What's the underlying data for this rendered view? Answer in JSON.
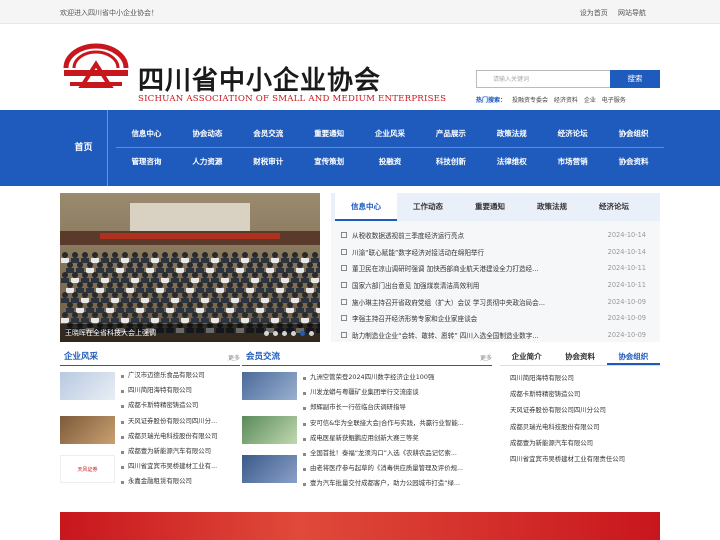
{
  "topbar": {
    "welcome": "欢迎进入四川省中小企业协会！",
    "links": [
      "设为首页",
      "网站导航"
    ]
  },
  "logo": {
    "cn": "四川省中小企业协会",
    "en": "SICHUAN ASSOCIATION OF SMALL AND MEDIUM ENTERPRISES"
  },
  "search": {
    "placeholder": "请输入关键词",
    "button": "搜索",
    "hot_label": "热门搜索：",
    "hot": [
      "投融资专委会",
      "经济资料",
      "企业",
      "电子服务"
    ]
  },
  "nav": {
    "home": "首页",
    "row1": [
      "信息中心",
      "协会动态",
      "会员交流",
      "重要通知",
      "企业风采",
      "产品展示",
      "政策法规",
      "经济论坛",
      "协会组织"
    ],
    "row2": [
      "管理咨询",
      "人力资源",
      "财税审计",
      "宣传策划",
      "投融资",
      "科技创新",
      "法律维权",
      "市场营销",
      "协会资料"
    ]
  },
  "slider": {
    "caption": "王晓晖在全省科技大会上强调",
    "dots": 6
  },
  "news": {
    "tabs": [
      "信息中心",
      "工作动态",
      "重要通知",
      "政策法规",
      "经济论坛"
    ],
    "items": [
      {
        "title": "从税收数据透视前三季度经济运行亮点",
        "date": "2024-10-14"
      },
      {
        "title": "川渝“联心赋能”数字经济对接活动在绵阳举行",
        "date": "2024-10-14"
      },
      {
        "title": "董卫民在凉山调研时强调 加快西部商业航天港建设全力打造经...",
        "date": "2024-10-11"
      },
      {
        "title": "国家六部门出台意见 加强煤炭清洁高效利用",
        "date": "2024-10-11"
      },
      {
        "title": "施小琳主持召开省政府党组（扩大）会议 学习贯彻中央政治局会...",
        "date": "2024-10-09"
      },
      {
        "title": "李强主持召开经济形势专家和企业家座谈会",
        "date": "2024-10-09"
      },
      {
        "title": "助力制造业企业“会转、敢转、愿转” 四川入选全国制造业数字...",
        "date": "2024-10-09"
      }
    ]
  },
  "fengcai": {
    "title": "企业风采",
    "more": "更多",
    "items": [
      "广汉市迈德乐食品有限公司",
      "四川简阳海特有限公司",
      "成都卡斯特精密铸造公司",
      "天风证券股份有限公司四川分...",
      "成都贝瑞光电科技股份有限公司",
      "成都壹为新能源汽车有限公司",
      "四川省宜宾市吴桥建材工业有...",
      "永嘉金融租赁有限公司"
    ],
    "badge": "天风证券"
  },
  "jiaoliu": {
    "title": "会员交流",
    "more": "更多",
    "items": [
      "九洲空管荣登2024四川数字经济企业100强",
      "川发龙蟒与粤疆矿业集团举行交流座谈",
      "郑辉副市长一行莅临台庆调研指导",
      "安可信&华为全联接大会|合作与实践，共赢行业智能...",
      "成电医星新获鲲鹏应用创新大赛三等奖",
      "全国首批！泰福“龙须沟口”入选《农耕农品记忆索...",
      "由老将医疗参与起草的《消毒供应质量管理及评价规...",
      "壹为汽车批量交付成都客户，助力公园城市打造“绿..."
    ]
  },
  "org": {
    "tabs": [
      "企业简介",
      "协会资料",
      "协会组织"
    ],
    "items": [
      "四川简阳海特有限公司",
      "成都卡斯特精密铸造公司",
      "天风证券股份有限公司四川分公司",
      "成都贝瑞光电科技股份有限公司",
      "成都壹为新能源汽车有限公司",
      "四川省宜宾市吴桥建材工业有限责任公司"
    ]
  },
  "colors": {
    "brand_blue": "#1e5bbd",
    "brand_red": "#c8161d"
  }
}
